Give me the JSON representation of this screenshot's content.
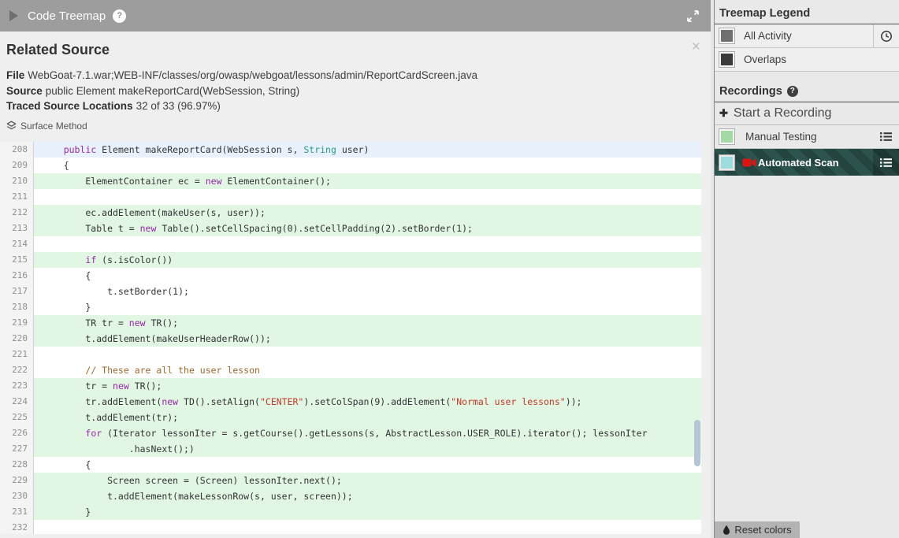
{
  "icons": {
    "help": "?",
    "close": "×",
    "plus": "✚"
  },
  "titlebar": {
    "title": "Code Treemap"
  },
  "panel": {
    "title": "Related Source",
    "meta": [
      {
        "label": "File",
        "value": "WebGoat-7.1.war;WEB-INF/classes/org/owasp/webgoat/lessons/admin/ReportCardScreen.java"
      },
      {
        "label": "Source",
        "value": "public Element makeReportCard(WebSession, String)"
      },
      {
        "label": "Traced Source Locations",
        "value": "32 of 33 (96.97%)"
      }
    ],
    "surface_method": "Surface Method"
  },
  "code": {
    "syntax_colors": {
      "keyword": "#9527a8",
      "type": "#2a9590",
      "string": "#c0392b",
      "comment": "#a0692f",
      "plain": "#333333"
    },
    "row_colors": {
      "traced": "#e1f6e3",
      "selected": "#e9f2fc",
      "default": "#ffffff"
    },
    "lines": [
      {
        "n": 208,
        "bg": "selected",
        "seg": [
          [
            "    ",
            ""
          ],
          [
            "public",
            "kw"
          ],
          [
            " Element makeReportCard(WebSession s, ",
            ""
          ],
          [
            "String",
            "ty"
          ],
          [
            " user)",
            ""
          ]
        ]
      },
      {
        "n": 209,
        "bg": "default",
        "seg": [
          [
            "    {",
            ""
          ]
        ]
      },
      {
        "n": 210,
        "bg": "traced",
        "seg": [
          [
            "        ElementContainer ec = ",
            ""
          ],
          [
            "new",
            "kw"
          ],
          [
            " ElementContainer();",
            ""
          ]
        ]
      },
      {
        "n": 211,
        "bg": "default",
        "seg": []
      },
      {
        "n": 212,
        "bg": "traced",
        "seg": [
          [
            "        ec.addElement(makeUser(s, user));",
            ""
          ]
        ]
      },
      {
        "n": 213,
        "bg": "traced",
        "seg": [
          [
            "        Table t = ",
            ""
          ],
          [
            "new",
            "kw"
          ],
          [
            " Table().setCellSpacing(0).setCellPadding(2).setBorder(1);",
            ""
          ]
        ]
      },
      {
        "n": 214,
        "bg": "default",
        "seg": []
      },
      {
        "n": 215,
        "bg": "traced",
        "seg": [
          [
            "        ",
            ""
          ],
          [
            "if",
            "kw"
          ],
          [
            " (s.isColor())",
            ""
          ]
        ]
      },
      {
        "n": 216,
        "bg": "default",
        "seg": [
          [
            "        {",
            ""
          ]
        ]
      },
      {
        "n": 217,
        "bg": "default",
        "seg": [
          [
            "            t.setBorder(1);",
            ""
          ]
        ]
      },
      {
        "n": 218,
        "bg": "default",
        "seg": [
          [
            "        }",
            ""
          ]
        ]
      },
      {
        "n": 219,
        "bg": "traced",
        "seg": [
          [
            "        TR tr = ",
            ""
          ],
          [
            "new",
            "kw"
          ],
          [
            " TR();",
            ""
          ]
        ]
      },
      {
        "n": 220,
        "bg": "traced",
        "seg": [
          [
            "        t.addElement(makeUserHeaderRow());",
            ""
          ]
        ]
      },
      {
        "n": 221,
        "bg": "default",
        "seg": []
      },
      {
        "n": 222,
        "bg": "default",
        "seg": [
          [
            "        ",
            ""
          ],
          [
            "// These are all the user lesson",
            "co"
          ]
        ]
      },
      {
        "n": 223,
        "bg": "traced",
        "seg": [
          [
            "        tr = ",
            ""
          ],
          [
            "new",
            "kw"
          ],
          [
            " TR();",
            ""
          ]
        ]
      },
      {
        "n": 224,
        "bg": "traced",
        "seg": [
          [
            "        tr.addElement(",
            ""
          ],
          [
            "new",
            "kw"
          ],
          [
            " TD().setAlign(",
            ""
          ],
          [
            "\"CENTER\"",
            "st"
          ],
          [
            ").setColSpan(9).addElement(",
            ""
          ],
          [
            "\"Normal user lessons\"",
            "st"
          ],
          [
            "));",
            ""
          ]
        ]
      },
      {
        "n": 225,
        "bg": "traced",
        "seg": [
          [
            "        t.addElement(tr);",
            ""
          ]
        ]
      },
      {
        "n": 226,
        "bg": "traced",
        "seg": [
          [
            "        ",
            ""
          ],
          [
            "for",
            "kw"
          ],
          [
            " (Iterator lessonIter = s.getCourse().getLessons(s, AbstractLesson.USER_ROLE).iterator(); lessonIter",
            ""
          ]
        ]
      },
      {
        "n": 227,
        "bg": "traced",
        "seg": [
          [
            "                .hasNext();)",
            ""
          ]
        ]
      },
      {
        "n": 228,
        "bg": "default",
        "seg": [
          [
            "        {",
            ""
          ]
        ]
      },
      {
        "n": 229,
        "bg": "traced",
        "seg": [
          [
            "            Screen screen = (Screen) lessonIter.next();",
            ""
          ]
        ]
      },
      {
        "n": 230,
        "bg": "traced",
        "seg": [
          [
            "            t.addElement(makeLessonRow(s, user, screen));",
            ""
          ]
        ]
      },
      {
        "n": 231,
        "bg": "traced",
        "seg": [
          [
            "        }",
            ""
          ]
        ]
      },
      {
        "n": 232,
        "bg": "default",
        "seg": []
      }
    ]
  },
  "sidebar": {
    "legend_title": "Treemap Legend",
    "legend": [
      {
        "label": "All Activity",
        "color": "#707070"
      },
      {
        "label": "Overlaps",
        "color": "#3b3b3b"
      }
    ],
    "recordings_title": "Recordings",
    "start_recording": "Start a Recording",
    "recordings": [
      {
        "label": "Manual Testing",
        "color": "#a5d9a5"
      },
      {
        "label": "Automated Scan",
        "color": "#9edddd",
        "selected": true
      }
    ],
    "selected_row_colors": {
      "base": "#2d534e",
      "stripe": "#24453f"
    },
    "reset_colors": "Reset colors"
  }
}
